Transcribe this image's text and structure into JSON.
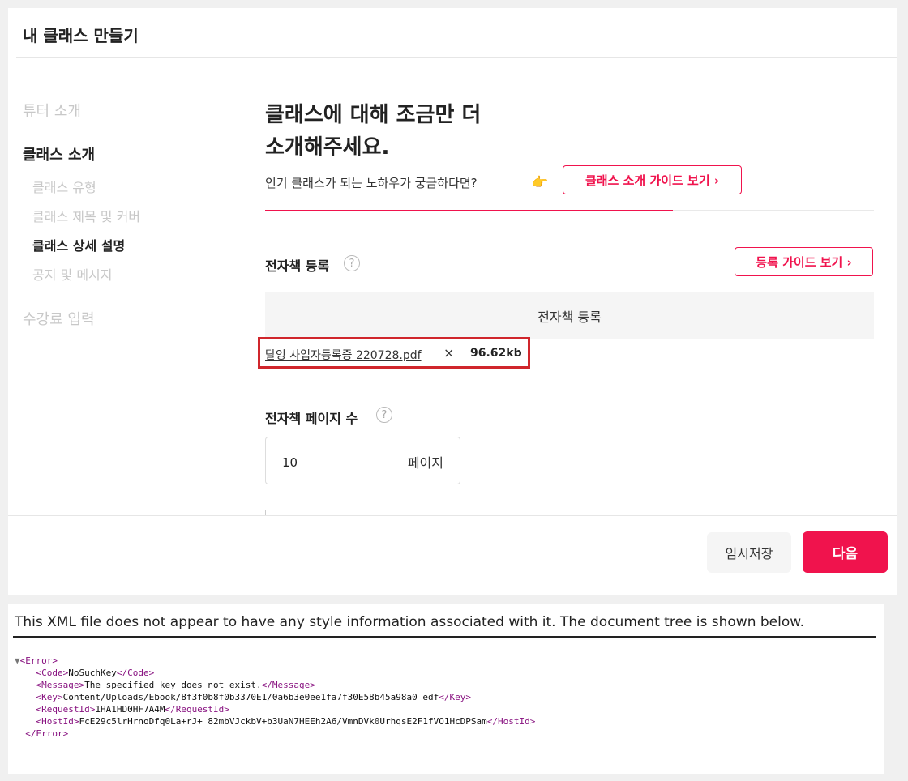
{
  "header": {
    "title": "내 클래스 만들기"
  },
  "sidebar": {
    "items": [
      {
        "label": "튜터 소개",
        "level": "main",
        "active": false
      },
      {
        "label": "클래스 소개",
        "level": "main",
        "active": true
      },
      {
        "label": "클래스 유형",
        "level": "sub",
        "active": false
      },
      {
        "label": "클래스 제목 및 커버",
        "level": "sub",
        "active": false
      },
      {
        "label": "클래스 상세 설명",
        "level": "sub",
        "active": true
      },
      {
        "label": "공지 및 메시지",
        "level": "sub",
        "active": false
      },
      {
        "label": "수강료 입력",
        "level": "main",
        "active": false
      }
    ]
  },
  "main": {
    "title_line1": "클래스에 대해 조금만 더",
    "title_line2": "소개해주세요.",
    "subtitle": "인기 클래스가 되는 노하우가 궁금하다면?",
    "hand_icon": "👉",
    "guide_button": "클래스 소개 가이드 보기 ›",
    "progress": 0.67,
    "ebook": {
      "label": "전자책 등록",
      "help": "?",
      "guide_button": "등록 가이드 보기 ›",
      "upload_label": "전자책 등록",
      "file_name": "탈잉 사업자등록증 220728.pdf",
      "remove": "×",
      "file_size": "96.62kb"
    },
    "pages": {
      "label": "전자책 페이지 수",
      "help": "?",
      "value": "10",
      "unit": "페이지"
    }
  },
  "footer": {
    "save_label": "임시저장",
    "next_label": "다음"
  },
  "colors": {
    "accent": "#f0134d",
    "highlight_box": "#d0262c",
    "xml_tag": "#881280"
  },
  "xml": {
    "notice": "This XML file does not appear to have any style information associated with it. The document tree is shown below.",
    "toggle": "▼",
    "error_open": "<Error>",
    "code_open": "<Code>",
    "code_value": "NoSuchKey",
    "code_close": "</Code>",
    "message_open": "<Message>",
    "message_value": "The specified key does not exist.",
    "message_close": "</Message>",
    "key_open": "<Key>",
    "key_value": "Content/Uploads/Ebook/8f3f0b8f0b3370E1/0a6b3e0ee1fa7f30E58b45a98a0 edf",
    "key_close": "</Key>",
    "request_open": "<RequestId>",
    "request_value": "1HA1HD0HF7A4M",
    "request_close": "</RequestId>",
    "host_open": "<HostId>",
    "host_value": "FcE29c5lrHrnoDfq0La+rJ+ 82mbVJckbV+b3UaN7HEEh2A6/VmnDVk0UrhqsE2F1fVO1HcDPSam",
    "host_close": "</HostId>",
    "error_close": "</Error>"
  }
}
